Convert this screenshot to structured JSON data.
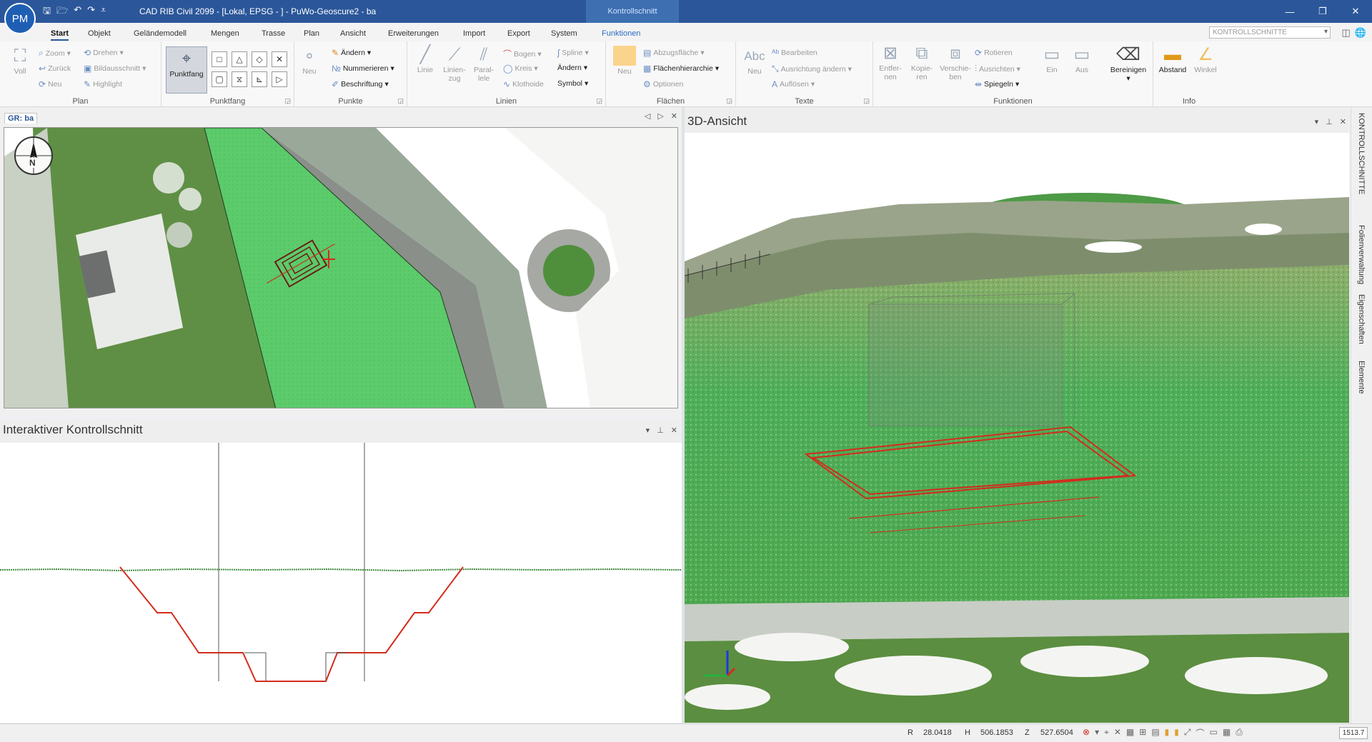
{
  "app": {
    "avatar": "PM",
    "title": "CAD RIB Civil 2099 - [Lokal, EPSG - ] - PuWo-Geoscure2 - ba",
    "context_tab": "Kontrollschnitt",
    "quick_access": [
      "save-icon",
      "open-icon",
      "undo-icon",
      "redo-icon",
      "customize-icon"
    ]
  },
  "menu": {
    "tabs": [
      "Start",
      "Objekt",
      "Geländemodell",
      "Mengen",
      "Trasse",
      "Plan",
      "Ansicht",
      "Erweiterungen",
      "Import",
      "Export",
      "System",
      "Funktionen"
    ],
    "active": "Start",
    "search_value": "KONTROLLSCHNITTE"
  },
  "ribbon": {
    "plan": {
      "label": "Plan",
      "voll": "Voll",
      "zoom": "Zoom",
      "zurueck": "Zurück",
      "neu": "Neu",
      "drehen": "Drehen",
      "bildausschnitt": "Bildausschnitt",
      "highlight": "Highlight"
    },
    "punktfang": {
      "label": "Punktfang",
      "button": "Punktfang",
      "modes": [
        "□",
        "△",
        "◇",
        "✕",
        "▢",
        "⧖",
        "⊾",
        "▷"
      ]
    },
    "punkte": {
      "label": "Punkte",
      "neu": "Neu",
      "aendern": "Ändern",
      "nummerieren": "Nummerieren",
      "beschriftung": "Beschriftung"
    },
    "linien": {
      "label": "Linien",
      "linie": "Linie",
      "linienzug": "Linien-\nzug",
      "parallele": "Paral-\nlele",
      "bogen": "Bogen",
      "kreis": "Kreis",
      "klothoide": "Klothoide",
      "spline": "Spline",
      "aendern": "Ändern",
      "symbol": "Symbol"
    },
    "flaechen": {
      "label": "Flächen",
      "neu": "Neu",
      "abzugsflaeche": "Abzugsfläche",
      "flaechenhierarchie": "Flächenhierarchie",
      "optionen": "Optionen"
    },
    "texte": {
      "label": "Texte",
      "neu": "Neu",
      "bearbeiten": "Bearbeiten",
      "ausrichtung": "Ausrichtung ändern",
      "aufloesen": "Auflösen"
    },
    "funktionen": {
      "label": "Funktionen",
      "entfernen": "Entfer-\nnen",
      "kopieren": "Kopie-\nren",
      "verschieben": "Verschie-\nben",
      "rotieren": "Rotieren",
      "ausrichten": "Ausrichten",
      "spiegeln": "Spiegeln",
      "ein": "Ein",
      "aus": "Aus",
      "bereinigen": "Bereinigen"
    },
    "info": {
      "label": "Info",
      "abstand": "Abstand",
      "winkel": "Winkel"
    }
  },
  "panels": {
    "plan_tab": "GR: ba",
    "section_title": "Interaktiver Kontrollschnitt",
    "view3d_title": "3D-Ansicht"
  },
  "side_tabs": [
    "KONTROLLSCHNITTE",
    "Folienverwaltung",
    "Eigenschaften",
    "Elemente"
  ],
  "compass": {
    "label": "N"
  },
  "status": {
    "r_label": "R",
    "r_value": "28.0418",
    "h_label": "H",
    "h_value": "506.1853",
    "z_label": "Z",
    "z_value": "527.6504",
    "zoom": "1513.7"
  },
  "colors": {
    "accent": "#2b579a",
    "section_line": "#d42b1c",
    "grass": "#5dbf62"
  }
}
